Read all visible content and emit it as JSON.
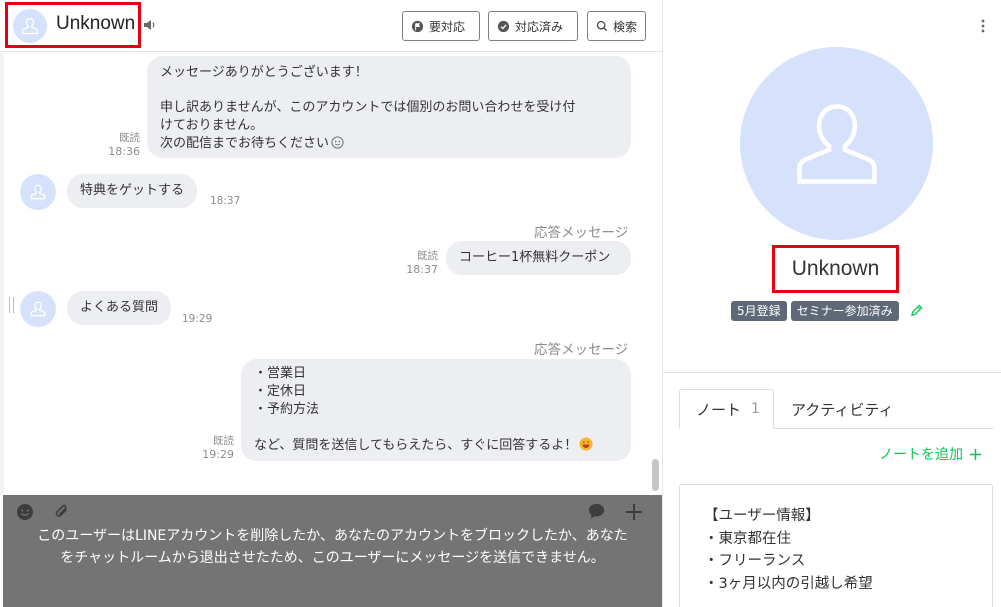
{
  "header": {
    "user_name": "Unknown",
    "buttons": {
      "needs_action": "要対応",
      "done": "対応済み",
      "search": "検索"
    }
  },
  "messages": [
    {
      "id": "m1",
      "side": "outgoing",
      "lines": [
        "メッセージありがとうございます！",
        "",
        "申し訳ありませんが、このアカウントでは個別のお問い合わせを受け付",
        "けておりません。",
        "次の配信までお待ちください"
      ],
      "read": "既読",
      "time": "18:36"
    },
    {
      "id": "m2",
      "side": "incoming",
      "text": "特典をゲットする",
      "time": "18:37"
    },
    {
      "id": "m3",
      "side": "outgoing",
      "auto_label": "応答メッセージ",
      "text": "コーヒー1杯無料クーポン",
      "read": "既読",
      "time": "18:37"
    },
    {
      "id": "m4",
      "side": "incoming",
      "text": "よくある質問",
      "time": "19:29"
    },
    {
      "id": "m5",
      "side": "outgoing",
      "auto_label": "応答メッセージ",
      "lines": [
        "・営業日",
        "・定休日",
        "・予約方法",
        "",
        "など、質問を送信してもらえたら、すぐに回答するよ！"
      ],
      "read": "既読",
      "time": "19:29"
    }
  ],
  "composer": {
    "blocked_message_line1": "このユーザーはLINEアカウントを削除したか、あなたのアカウントをブロックしたか、あなた",
    "blocked_message_line2": "をチャットルームから退出させたため、このユーザーにメッセージを送信できません。"
  },
  "profile": {
    "name": "Unknown",
    "tags": [
      "5月登録",
      "セミナー参加済み"
    ],
    "tabs": {
      "note_label": "ノート",
      "note_count": "1",
      "activity_label": "アクティビティ"
    },
    "add_note": "ノートを追加",
    "note_lines": [
      "【ユーザー情報】",
      "・東京都在住",
      "・フリーランス",
      "・3ヶ月以内の引越し希望"
    ]
  },
  "colors": {
    "highlight": "#e60012",
    "line_green": "#06c755",
    "avatar_bg": "#d6e2fb",
    "bubble_bg": "#eceef1",
    "tag_bg": "#5f6877",
    "composer_overlay": "#747474"
  },
  "icons": [
    "user-avatar-icon",
    "speaker-icon",
    "flag-icon",
    "check-bubble-icon",
    "search-icon",
    "emoji-icon",
    "paperclip-icon",
    "speech-bubble-icon",
    "plus-icon",
    "kebab-menu-icon",
    "pencil-icon"
  ]
}
